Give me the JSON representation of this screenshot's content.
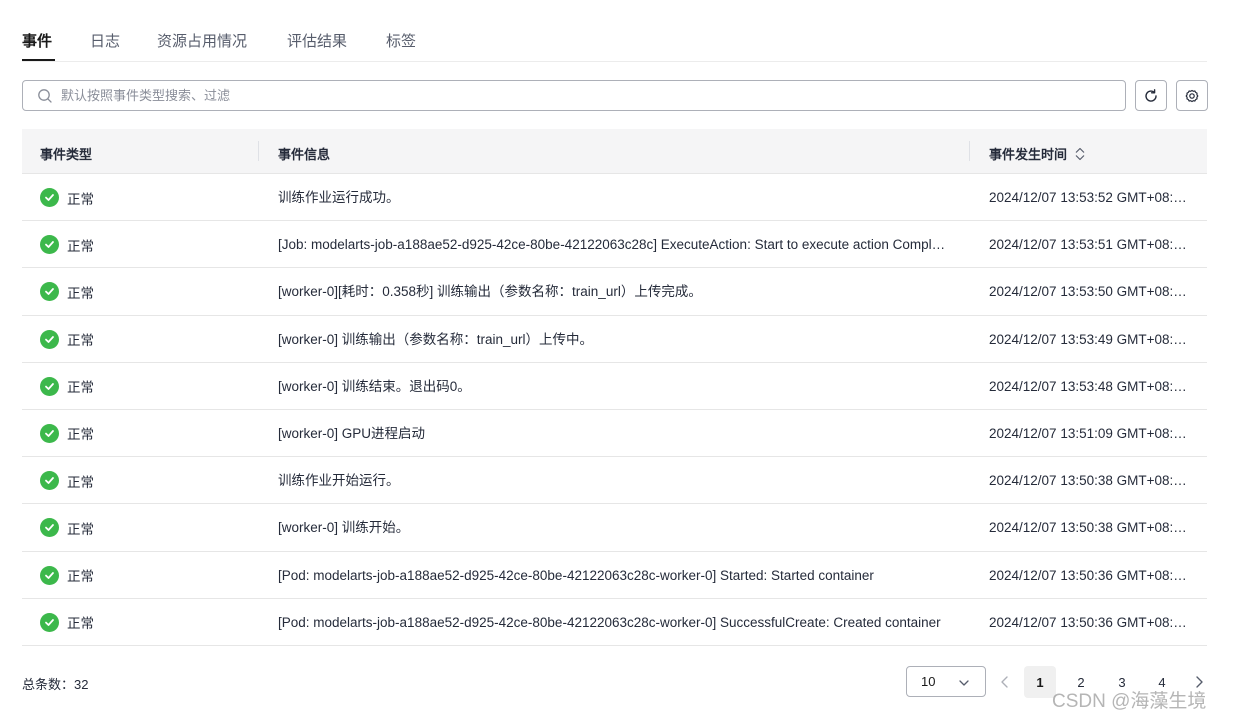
{
  "tabs": [
    {
      "label": "事件",
      "active": true
    },
    {
      "label": "日志"
    },
    {
      "label": "资源占用情况"
    },
    {
      "label": "评估结果"
    },
    {
      "label": "标签"
    }
  ],
  "search": {
    "placeholder": "默认按照事件类型搜索、过滤"
  },
  "table": {
    "headers": {
      "type": "事件类型",
      "info": "事件信息",
      "time": "事件发生时间"
    },
    "rows": [
      {
        "type": "正常",
        "info": "训练作业运行成功。",
        "time": "2024/12/07 13:53:52 GMT+08:…"
      },
      {
        "type": "正常",
        "info": "[Job: modelarts-job-a188ae52-d925-42ce-80be-42122063c28c] ExecuteAction: Start to execute action Compl…",
        "time": "2024/12/07 13:53:51 GMT+08:…"
      },
      {
        "type": "正常",
        "info": "[worker-0][耗时：0.358秒] 训练输出（参数名称：train_url）上传完成。",
        "time": "2024/12/07 13:53:50 GMT+08:…"
      },
      {
        "type": "正常",
        "info": "[worker-0] 训练输出（参数名称：train_url）上传中。",
        "time": "2024/12/07 13:53:49 GMT+08:…"
      },
      {
        "type": "正常",
        "info": "[worker-0] 训练结束。退出码0。",
        "time": "2024/12/07 13:53:48 GMT+08:…"
      },
      {
        "type": "正常",
        "info": "[worker-0] GPU进程启动",
        "time": "2024/12/07 13:51:09 GMT+08:…"
      },
      {
        "type": "正常",
        "info": "训练作业开始运行。",
        "time": "2024/12/07 13:50:38 GMT+08:…"
      },
      {
        "type": "正常",
        "info": "[worker-0] 训练开始。",
        "time": "2024/12/07 13:50:38 GMT+08:…"
      },
      {
        "type": "正常",
        "info": "[Pod: modelarts-job-a188ae52-d925-42ce-80be-42122063c28c-worker-0] Started: Started container",
        "time": "2024/12/07 13:50:36 GMT+08:…"
      },
      {
        "type": "正常",
        "info": "[Pod: modelarts-job-a188ae52-d925-42ce-80be-42122063c28c-worker-0] SuccessfulCreate: Created container",
        "time": "2024/12/07 13:50:36 GMT+08:…"
      }
    ]
  },
  "footer": {
    "total_label": "总条数：32",
    "page_size": "10",
    "pages": [
      "1",
      "2",
      "3",
      "4"
    ],
    "current_page": "1"
  },
  "watermark": "CSDN @海藻生境",
  "colors": {
    "status_ok": "#3cb84b",
    "tab_active": "#191919"
  }
}
